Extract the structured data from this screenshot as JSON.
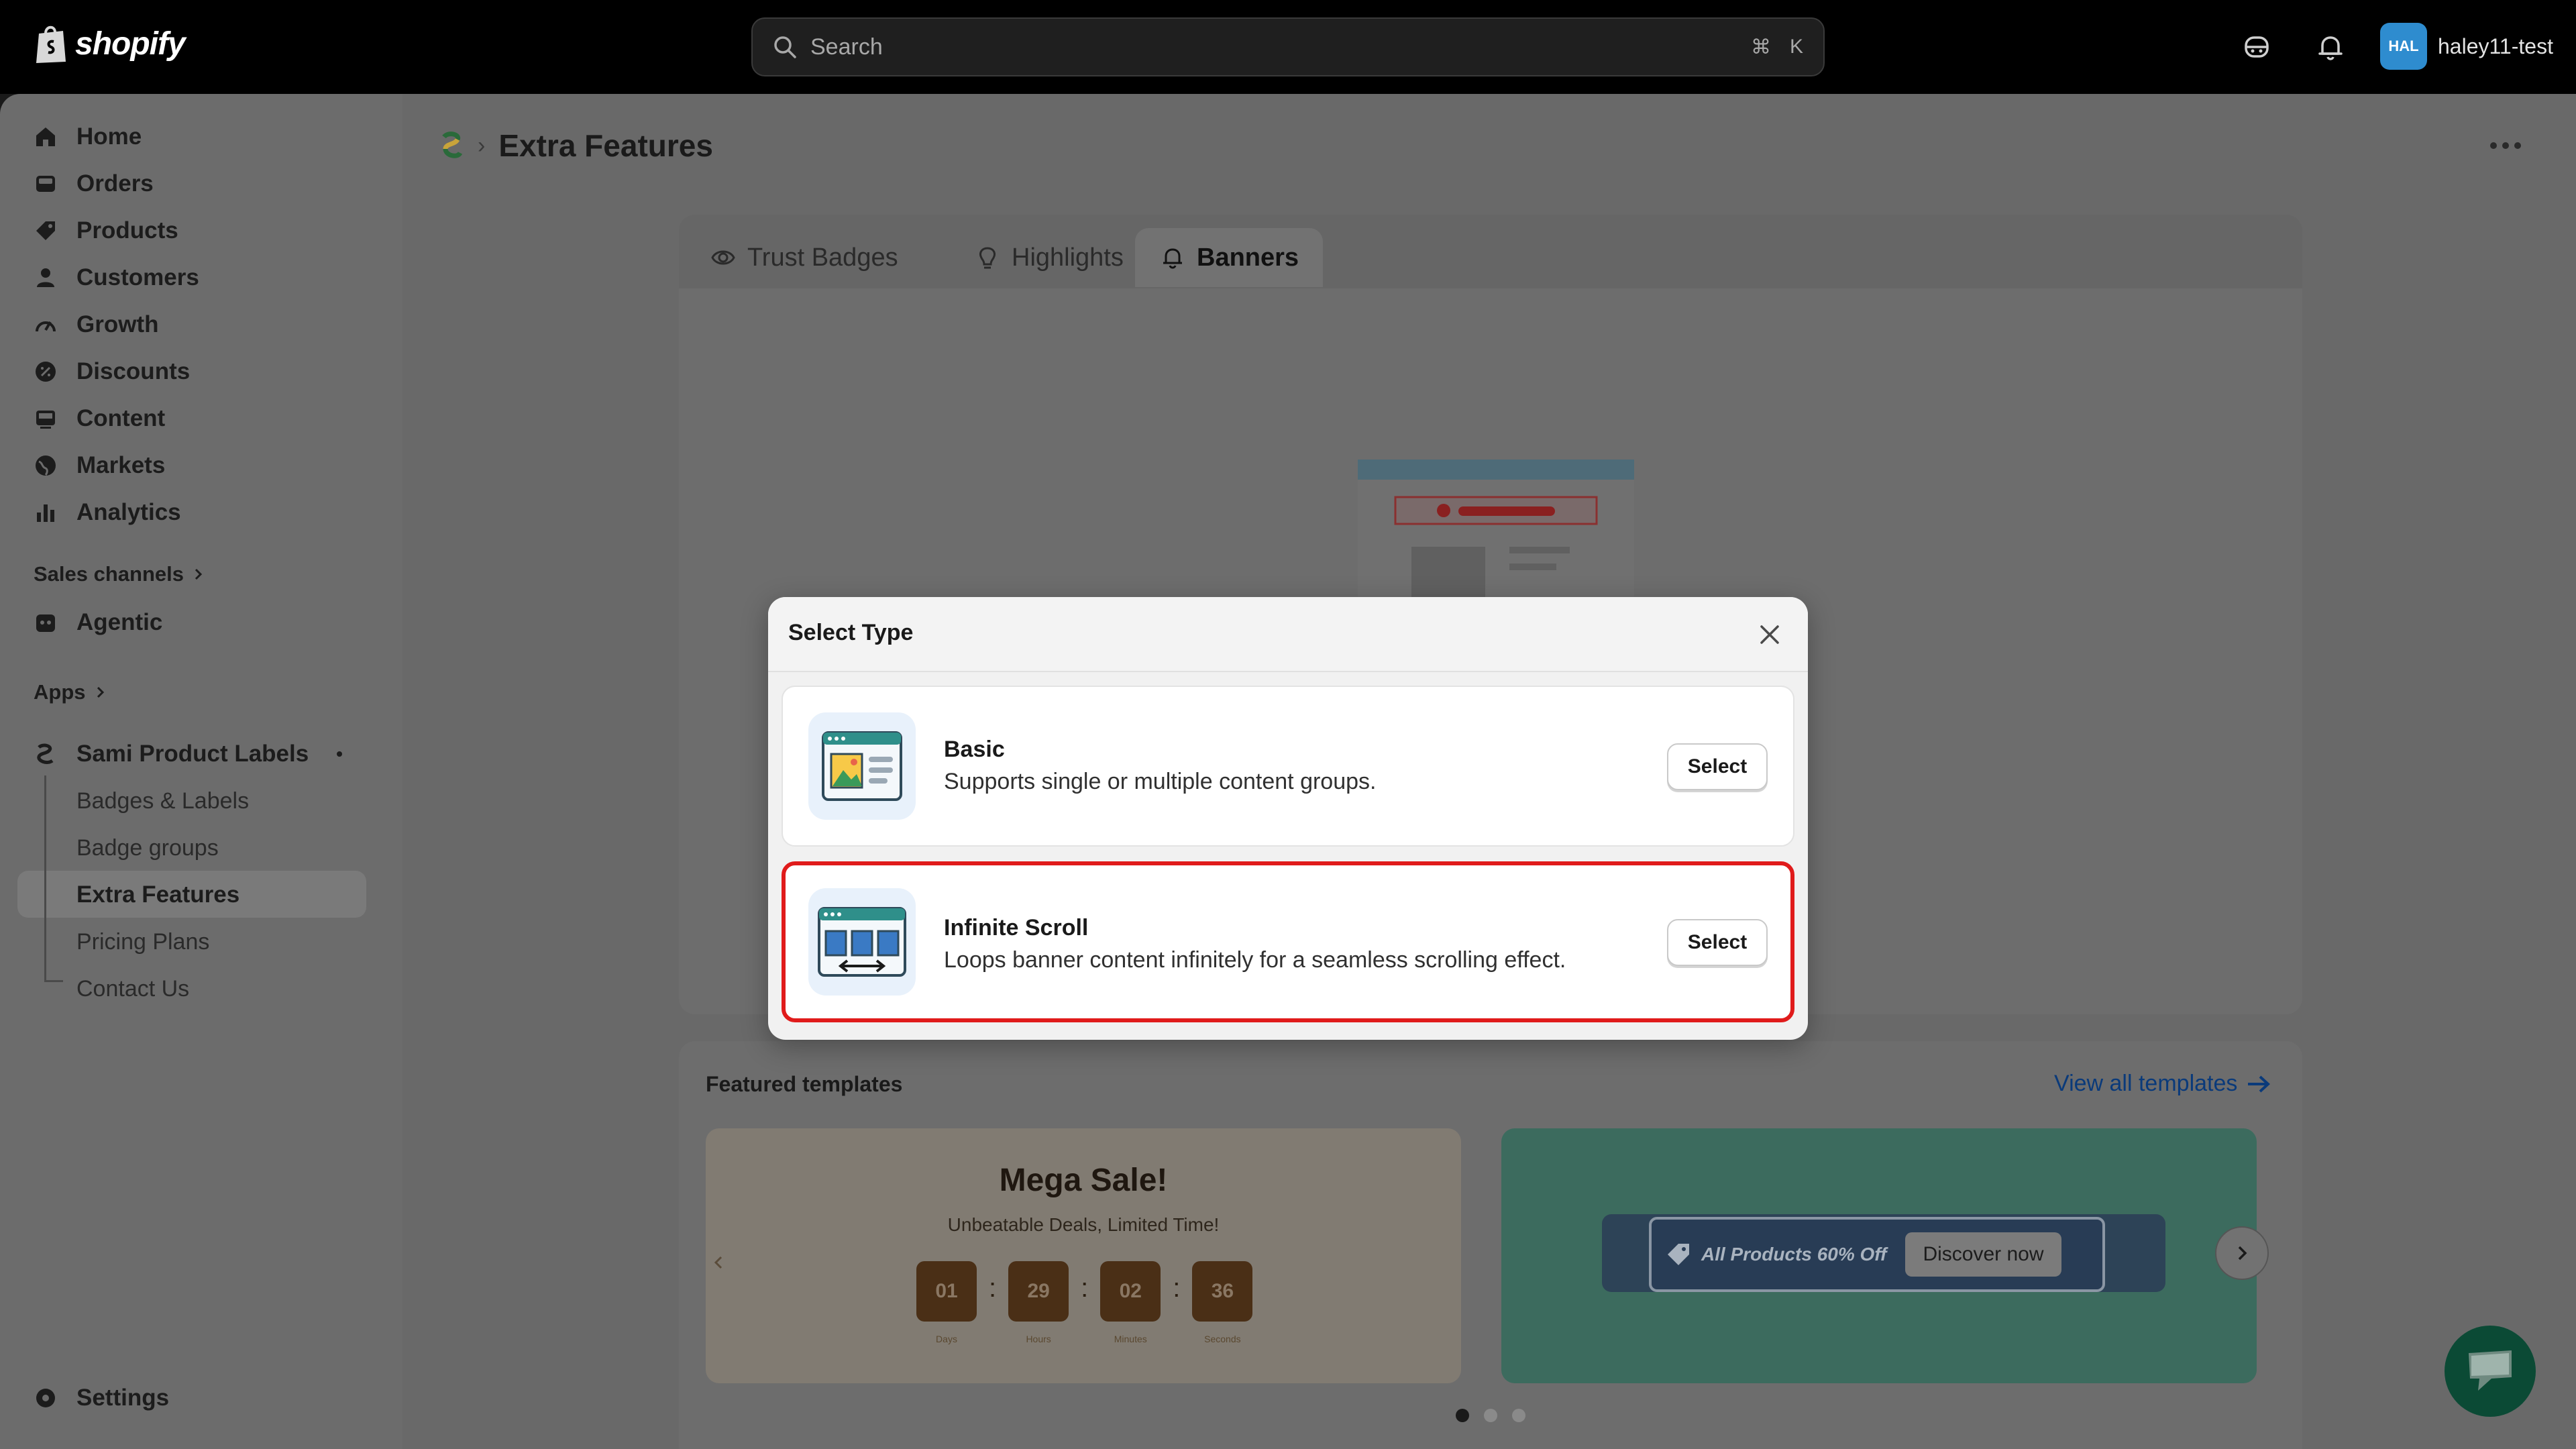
{
  "topbar": {
    "brand": "shopify",
    "search_placeholder": "Search",
    "shortcut_cmd": "⌘",
    "shortcut_key": "K",
    "avatar_initials": "HAL",
    "username": "haley11-test"
  },
  "sidebar": {
    "items": [
      {
        "label": "Home",
        "icon": "home-icon"
      },
      {
        "label": "Orders",
        "icon": "inbox-icon"
      },
      {
        "label": "Products",
        "icon": "tag-icon"
      },
      {
        "label": "Customers",
        "icon": "person-icon"
      },
      {
        "label": "Growth",
        "icon": "gauge-icon"
      },
      {
        "label": "Discounts",
        "icon": "discount-icon"
      },
      {
        "label": "Content",
        "icon": "image-icon"
      },
      {
        "label": "Markets",
        "icon": "globe-icon"
      },
      {
        "label": "Analytics",
        "icon": "bar-chart-icon"
      }
    ],
    "sales_channels_label": "Sales channels",
    "agentic_label": "Agentic",
    "apps_label": "Apps",
    "app_name": "Sami Product Labels",
    "app_subitems": [
      "Badges & Labels",
      "Badge groups",
      "Extra Features",
      "Pricing Plans",
      "Contact Us"
    ],
    "settings_label": "Settings"
  },
  "page": {
    "title": "Extra Features",
    "tabs": [
      "Trust Badges",
      "Highlights",
      "Banners"
    ],
    "active_tab": "Banners",
    "partial_text": "day"
  },
  "featured": {
    "heading": "Featured templates",
    "view_all": "View all templates",
    "template1": {
      "title": "Mega Sale!",
      "subtitle": "Unbeatable Deals, Limited Time!",
      "timer": [
        {
          "value": "01",
          "label": "Days"
        },
        {
          "value": "29",
          "label": "Hours"
        },
        {
          "value": "02",
          "label": "Minutes"
        },
        {
          "value": "36",
          "label": "Seconds"
        }
      ]
    },
    "template2": {
      "promo_text": "All Products 60% Off",
      "button": "Discover now"
    }
  },
  "modal": {
    "title": "Select Type",
    "options": [
      {
        "title": "Basic",
        "description": "Supports single or multiple content groups.",
        "button": "Select"
      },
      {
        "title": "Infinite Scroll",
        "description": "Loops banner content infinitely for a seamless scrolling effect.",
        "button": "Select"
      }
    ]
  },
  "colors": {
    "highlight_border": "#e01b1b",
    "link": "#0a3a7a",
    "chat_bubble": "#0b4a35"
  }
}
